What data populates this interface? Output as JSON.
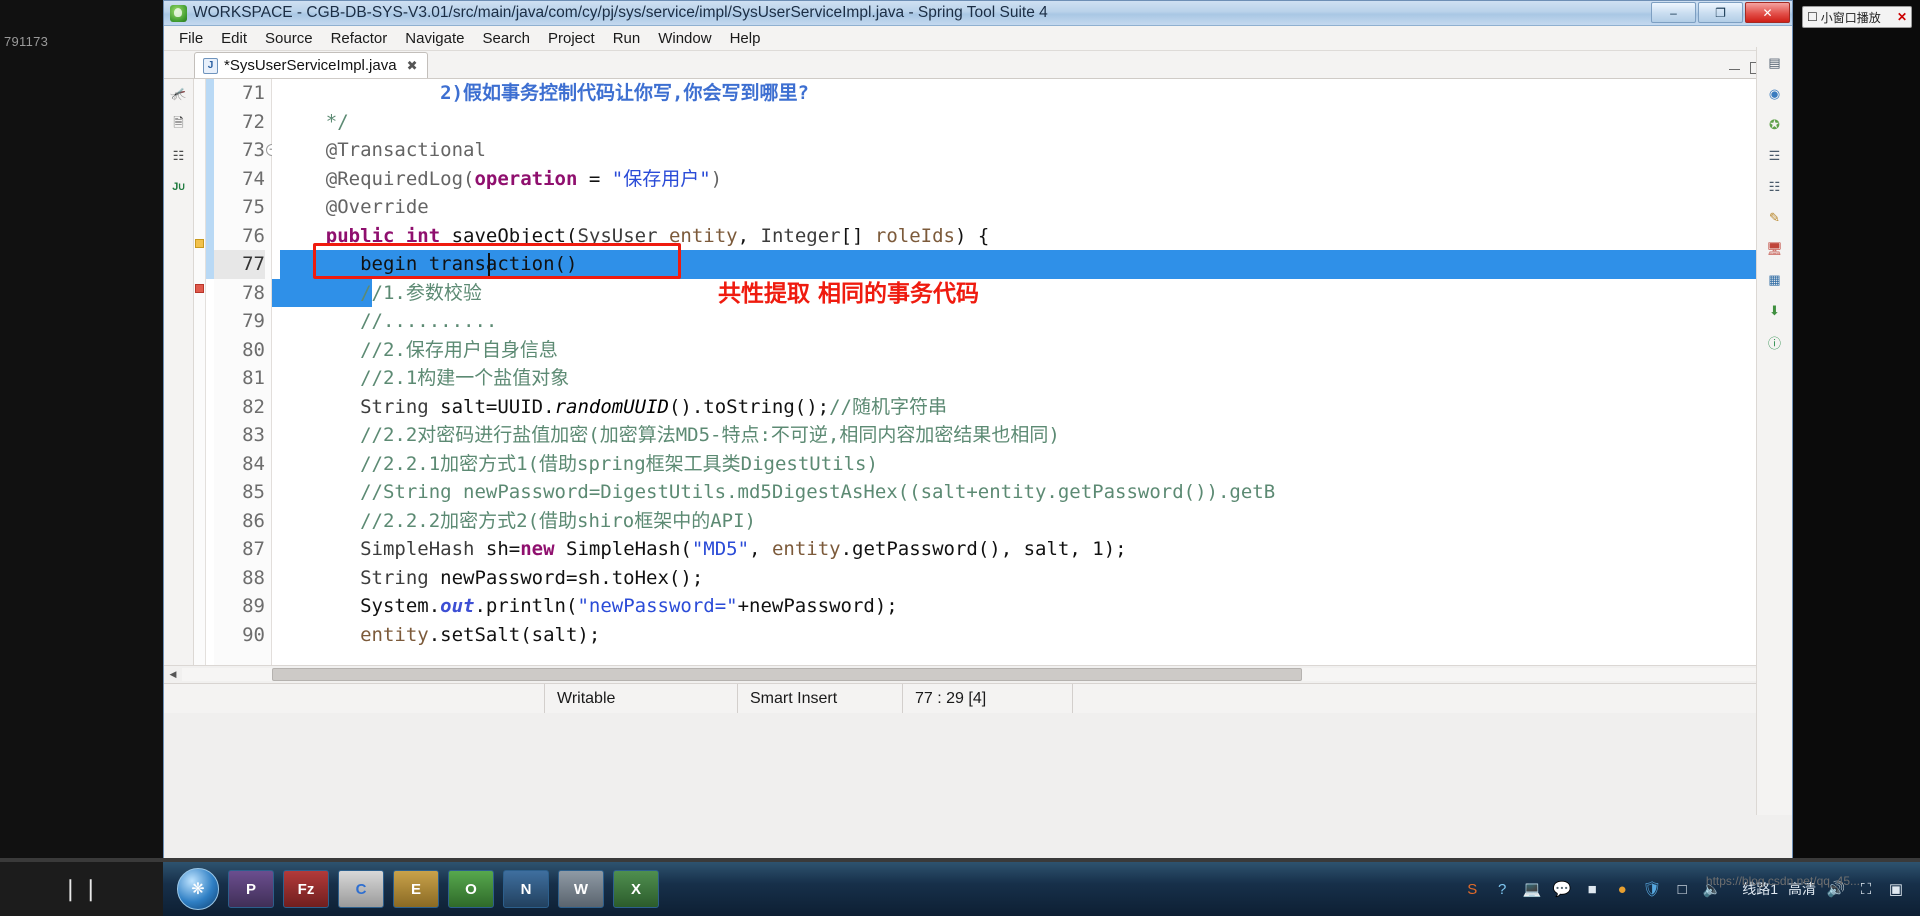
{
  "window": {
    "title": "WORKSPACE - CGB-DB-SYS-V3.01/src/main/java/com/cy/pj/sys/service/impl/SysUserServiceImpl.java - Spring Tool Suite 4",
    "minimize_label": "–",
    "maximize_label": "❐",
    "close_label": "✕"
  },
  "menubar": [
    {
      "label": "File"
    },
    {
      "label": "Edit"
    },
    {
      "label": "Source"
    },
    {
      "label": "Refactor"
    },
    {
      "label": "Navigate"
    },
    {
      "label": "Search"
    },
    {
      "label": "Project"
    },
    {
      "label": "Run"
    },
    {
      "label": "Window"
    },
    {
      "label": "Help"
    }
  ],
  "tab": {
    "label": "*SysUserServiceImpl.java",
    "file_icon_letter": "J",
    "close_label": "✖"
  },
  "left_rail_icons": [
    "bug-icon",
    "copy-icon",
    "outline-icon",
    "junit-icon"
  ],
  "right_rail_icons": [
    "properties-icon",
    "beans-icon",
    "spring-icon",
    "navigator-icon",
    "outline-icon",
    "tasks-icon",
    "servers-icon",
    "console-icon",
    "download-icon",
    "help-icon"
  ],
  "editor": {
    "first_line": 71,
    "current_line": 77,
    "lines": [
      {
        "n": 71,
        "tokens": [
          {
            "t": "              ",
            "c": "pln"
          },
          {
            "t": "2)假如事务控制代码让你写,你会写到哪里?",
            "c": "jdoc"
          }
        ]
      },
      {
        "n": 72,
        "tokens": [
          {
            "t": "    ",
            "c": "pln"
          },
          {
            "t": "*/",
            "c": "cmt"
          }
        ]
      },
      {
        "n": 73,
        "fold": true,
        "tokens": [
          {
            "t": "    ",
            "c": "pln"
          },
          {
            "t": "@Transactional",
            "c": "ann"
          }
        ]
      },
      {
        "n": 74,
        "tokens": [
          {
            "t": "    ",
            "c": "pln"
          },
          {
            "t": "@RequiredLog(",
            "c": "ann"
          },
          {
            "t": "operation",
            "c": "kw"
          },
          {
            "t": " = ",
            "c": "pln"
          },
          {
            "t": "\"保存用户\"",
            "c": "str"
          },
          {
            "t": ")",
            "c": "ann"
          }
        ]
      },
      {
        "n": 75,
        "tokens": [
          {
            "t": "    ",
            "c": "pln"
          },
          {
            "t": "@Override",
            "c": "ann"
          }
        ]
      },
      {
        "n": 76,
        "tokens": [
          {
            "t": "    ",
            "c": "pln"
          },
          {
            "t": "public int",
            "c": "kw"
          },
          {
            "t": " saveObject(",
            "c": "pln"
          },
          {
            "t": "SysUser",
            "c": "typ"
          },
          {
            "t": " ",
            "c": "pln"
          },
          {
            "t": "entity",
            "c": "prm"
          },
          {
            "t": ", ",
            "c": "pln"
          },
          {
            "t": "Integer",
            "c": "typ"
          },
          {
            "t": "[] ",
            "c": "pln"
          },
          {
            "t": "roleIds",
            "c": "prm"
          },
          {
            "t": ") {",
            "c": "pln"
          }
        ]
      },
      {
        "n": 77,
        "selected": true,
        "tokens": [
          {
            "t": "       begin transaction()",
            "c": "pln"
          }
        ]
      },
      {
        "n": 78,
        "tokens": [
          {
            "t": "       //1.参数校验",
            "c": "cmt"
          }
        ]
      },
      {
        "n": 79,
        "tokens": [
          {
            "t": "       //..........",
            "c": "cmt"
          }
        ]
      },
      {
        "n": 80,
        "tokens": [
          {
            "t": "       //2.保存用户自身信息",
            "c": "cmt"
          }
        ]
      },
      {
        "n": 81,
        "tokens": [
          {
            "t": "       //2.1构建一个盐值对象",
            "c": "cmt"
          }
        ]
      },
      {
        "n": 82,
        "tokens": [
          {
            "t": "       ",
            "c": "pln"
          },
          {
            "t": "String",
            "c": "typ"
          },
          {
            "t": " salt=UUID.",
            "c": "pln"
          },
          {
            "t": "randomUUID",
            "c": "ital"
          },
          {
            "t": "().toString();",
            "c": "pln"
          },
          {
            "t": "//随机字符串",
            "c": "cmt"
          }
        ]
      },
      {
        "n": 83,
        "tokens": [
          {
            "t": "       //2.2对密码进行盐值加密(加密算法MD5-特点:不可逆,相同内容加密结果也相同)",
            "c": "cmt"
          }
        ]
      },
      {
        "n": 84,
        "tokens": [
          {
            "t": "       //2.2.1加密方式1(借助spring框架工具类DigestUtils)",
            "c": "cmt"
          }
        ]
      },
      {
        "n": 85,
        "tokens": [
          {
            "t": "       //String newPassword=DigestUtils.md5DigestAsHex((salt+entity.getPassword()).getB",
            "c": "cmt"
          }
        ]
      },
      {
        "n": 86,
        "tokens": [
          {
            "t": "       //2.2.2加密方式2(借助shiro框架中的API)",
            "c": "cmt"
          }
        ]
      },
      {
        "n": 87,
        "tokens": [
          {
            "t": "       ",
            "c": "pln"
          },
          {
            "t": "SimpleHash",
            "c": "typ"
          },
          {
            "t": " sh=",
            "c": "pln"
          },
          {
            "t": "new",
            "c": "kw"
          },
          {
            "t": " SimpleHash(",
            "c": "pln"
          },
          {
            "t": "\"MD5\"",
            "c": "str"
          },
          {
            "t": ", ",
            "c": "pln"
          },
          {
            "t": "entity",
            "c": "prm"
          },
          {
            "t": ".getPassword(), salt, ",
            "c": "pln"
          },
          {
            "t": "1",
            "c": "pln"
          },
          {
            "t": ");",
            "c": "pln"
          }
        ]
      },
      {
        "n": 88,
        "tokens": [
          {
            "t": "       ",
            "c": "pln"
          },
          {
            "t": "String",
            "c": "typ"
          },
          {
            "t": " newPassword=sh.toHex();",
            "c": "pln"
          }
        ]
      },
      {
        "n": 89,
        "tokens": [
          {
            "t": "       System.",
            "c": "pln"
          },
          {
            "t": "out",
            "c": "fld"
          },
          {
            "t": ".println(",
            "c": "pln"
          },
          {
            "t": "\"newPassword=\"",
            "c": "str"
          },
          {
            "t": "+newPassword);",
            "c": "pln"
          }
        ]
      },
      {
        "n": 90,
        "tokens": [
          {
            "t": "       ",
            "c": "pln"
          },
          {
            "t": "entity",
            "c": "prm"
          },
          {
            "t": ".setSalt(salt);",
            "c": "pln"
          }
        ]
      }
    ]
  },
  "annotations": {
    "red_box_name": "begin-transaction-highlight-box",
    "red_text": "共性提取 相同的事务代码"
  },
  "statusbar": {
    "writable": "Writable",
    "insert_mode": "Smart Insert",
    "cursor_position": "77 : 29 [4]"
  },
  "floating_window": {
    "title": "小窗口播放",
    "close_label": "✕"
  },
  "player": {
    "pause_label": "❘❘",
    "timer": "791173",
    "line_label": "线路1",
    "quality_label": "高清",
    "volume_icon": "volume-icon",
    "fullscreen_icon": "fullscreen-icon",
    "expand_icon": "expand-icon",
    "watermark": "https://blog.csdn.net/qq_45..."
  },
  "taskbar": {
    "apps": [
      "P",
      "Fz",
      "C",
      "E",
      "O",
      "N",
      "W",
      "X"
    ]
  },
  "colors": {
    "selection_blue": "#2f90e8",
    "annotation_red": "#ef1b0f",
    "comment_green": "#5c8a73",
    "keyword_magenta": "#8f0f6e",
    "string_blue": "#2a4bd7"
  }
}
